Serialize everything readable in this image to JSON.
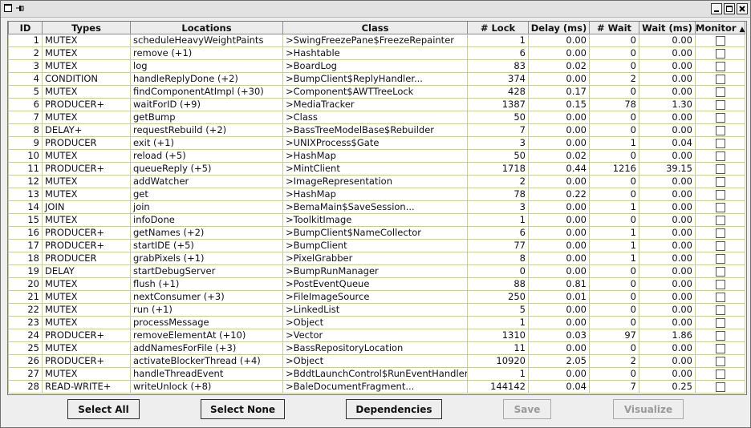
{
  "columns": [
    "ID",
    "Types",
    "Locations",
    "Class",
    "# Lock",
    "Delay (ms)",
    "# Wait",
    "Wait (ms)",
    "Monitor"
  ],
  "rows": [
    [
      "1",
      "MUTEX",
      "scheduleHeavyWeightPaints",
      ">SwingFreezePane$FreezeRepainter",
      "1",
      "0.00",
      "0",
      "0.00"
    ],
    [
      "2",
      "MUTEX",
      "remove (+1)",
      ">Hashtable",
      "6",
      "0.00",
      "0",
      "0.00"
    ],
    [
      "3",
      "MUTEX",
      "log",
      ">BoardLog",
      "83",
      "0.02",
      "0",
      "0.00"
    ],
    [
      "4",
      "CONDITION",
      "handleReplyDone (+2)",
      ">BumpClient$ReplyHandler...",
      "374",
      "0.00",
      "2",
      "0.00"
    ],
    [
      "5",
      "MUTEX",
      "findComponentAtImpl (+30)",
      ">Component$AWTTreeLock",
      "428",
      "0.17",
      "0",
      "0.00"
    ],
    [
      "6",
      "PRODUCER+",
      "waitForID (+9)",
      ">MediaTracker",
      "1387",
      "0.15",
      "78",
      "1.30"
    ],
    [
      "7",
      "MUTEX",
      "getBump",
      ">Class",
      "50",
      "0.00",
      "0",
      "0.00"
    ],
    [
      "8",
      "DELAY+",
      "requestRebuild (+2)",
      ">BassTreeModelBase$Rebuilder",
      "7",
      "0.00",
      "0",
      "0.00"
    ],
    [
      "9",
      "PRODUCER",
      "exit (+1)",
      ">UNIXProcess$Gate",
      "3",
      "0.00",
      "1",
      "0.04"
    ],
    [
      "10",
      "MUTEX",
      "reload (+5)",
      ">HashMap",
      "50",
      "0.02",
      "0",
      "0.00"
    ],
    [
      "11",
      "PRODUCER+",
      "queueReply (+5)",
      ">MintClient",
      "1718",
      "0.44",
      "1216",
      "39.15"
    ],
    [
      "12",
      "MUTEX",
      "addWatcher",
      ">ImageRepresentation",
      "2",
      "0.00",
      "0",
      "0.00"
    ],
    [
      "13",
      "MUTEX",
      "get",
      ">HashMap",
      "78",
      "0.22",
      "0",
      "0.00"
    ],
    [
      "14",
      "JOIN",
      "join",
      ">BemaMain$SaveSession...",
      "3",
      "0.00",
      "1",
      "0.00"
    ],
    [
      "15",
      "MUTEX",
      "infoDone",
      ">ToolkitImage",
      "1",
      "0.00",
      "0",
      "0.00"
    ],
    [
      "16",
      "PRODUCER+",
      "getNames (+2)",
      ">BumpClient$NameCollector",
      "6",
      "0.00",
      "1",
      "0.00"
    ],
    [
      "17",
      "PRODUCER+",
      "startIDE (+5)",
      ">BumpClient",
      "77",
      "0.00",
      "1",
      "0.00"
    ],
    [
      "18",
      "PRODUCER",
      "grabPixels (+1)",
      ">PixelGrabber",
      "8",
      "0.00",
      "1",
      "0.00"
    ],
    [
      "19",
      "DELAY",
      "startDebugServer",
      ">BumpRunManager",
      "0",
      "0.00",
      "0",
      "0.00"
    ],
    [
      "20",
      "MUTEX",
      "flush (+1)",
      ">PostEventQueue",
      "88",
      "0.81",
      "0",
      "0.00"
    ],
    [
      "21",
      "MUTEX",
      "nextConsumer (+3)",
      ">FileImageSource",
      "250",
      "0.01",
      "0",
      "0.00"
    ],
    [
      "22",
      "MUTEX",
      "run (+1)",
      ">LinkedList",
      "5",
      "0.00",
      "0",
      "0.00"
    ],
    [
      "23",
      "MUTEX",
      "processMessage",
      ">Object",
      "1",
      "0.00",
      "0",
      "0.00"
    ],
    [
      "24",
      "PRODUCER+",
      "removeElementAt (+10)",
      ">Vector",
      "1310",
      "0.03",
      "97",
      "1.86"
    ],
    [
      "25",
      "MUTEX",
      "addNamesForFile (+3)",
      ">BassRepositoryLocation",
      "11",
      "0.00",
      "0",
      "0.00"
    ],
    [
      "26",
      "PRODUCER+",
      "activateBlockerThread (+4)",
      ">Object",
      "10920",
      "2.05",
      "2",
      "0.00"
    ],
    [
      "27",
      "MUTEX",
      "handleThreadEvent",
      ">BddtLaunchControl$RunEventHandler",
      "1",
      "0.00",
      "0",
      "0.00"
    ],
    [
      "28",
      "READ-WRITE+",
      "writeUnlock (+8)",
      ">BaleDocumentFragment...",
      "144142",
      "0.04",
      "7",
      "0.25"
    ]
  ],
  "buttons": {
    "select_all": "Select All",
    "select_none": "Select None",
    "dependencies": "Dependencies",
    "save": "Save",
    "visualize": "Visualize"
  },
  "icons": {
    "monitor_sort": "sort-ascending-icon",
    "window_system": "window-menu-icon",
    "pin": "pin-icon"
  }
}
